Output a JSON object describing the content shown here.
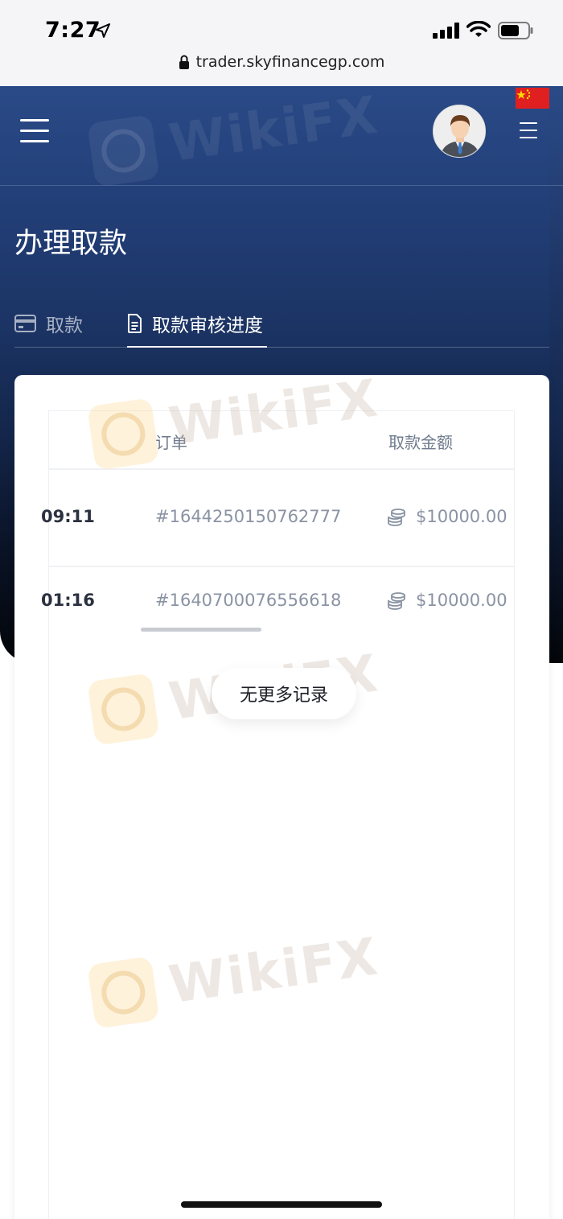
{
  "status_bar": {
    "time": "7:27",
    "url": "trader.skyfinancegp.com"
  },
  "header": {
    "page_title": "办理取款"
  },
  "tabs": [
    {
      "label": "取款",
      "active": false
    },
    {
      "label": "取款审核进度",
      "active": true
    }
  ],
  "table": {
    "columns": {
      "order": "订单",
      "amount": "取款金额"
    },
    "rows": [
      {
        "time": "09:11",
        "order": "#1644250150762777",
        "amount": "$10000.00"
      },
      {
        "time": "01:16",
        "order": "#1640700076556618",
        "amount": "$10000.00"
      }
    ]
  },
  "footer_notice": "无更多记录",
  "watermark": "WikiFX",
  "colors": {
    "header_gradient_top": "#2a4a87",
    "header_gradient_bottom": "#030509",
    "flag_red": "#e02020",
    "muted_text": "#8a93a3"
  }
}
